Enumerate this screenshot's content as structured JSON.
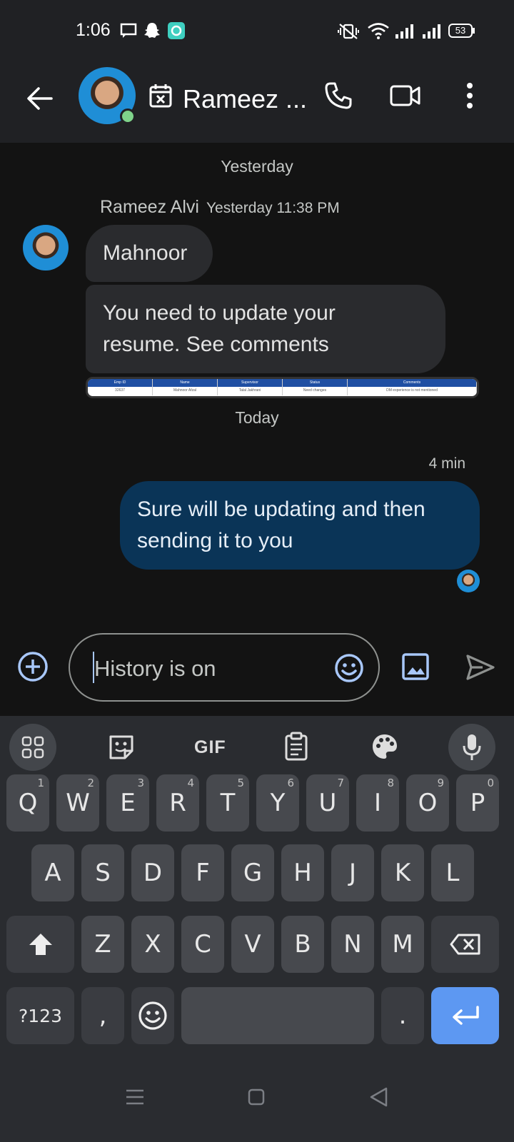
{
  "status_bar": {
    "time": "1:06",
    "battery": "53"
  },
  "header": {
    "contact_name": "Rameez ..."
  },
  "conversation": {
    "date_yesterday": "Yesterday",
    "sender_name": "Rameez Alvi",
    "sender_timestamp": "Yesterday 11:38 PM",
    "incoming": [
      {
        "lines": [
          "Mahnoor"
        ]
      },
      {
        "lines": [
          "You need to update your",
          "resume. See comments"
        ]
      }
    ],
    "attachment_table": {
      "headers": [
        "Emp ID",
        "Name",
        "Supervisor",
        "Status",
        "Comments"
      ],
      "row": [
        "32637",
        "Mahnoor Afzal",
        "Talal Jakhrani",
        "Need changes",
        "DM experience is not mentioned"
      ]
    },
    "date_today": "Today",
    "outgoing_time": "4 min",
    "outgoing": {
      "lines": [
        "Sure will be updating and then",
        "sending it to you"
      ]
    }
  },
  "composer": {
    "placeholder": "History is on"
  },
  "keyboard": {
    "toolbar_gif": "GIF",
    "row1": [
      [
        "Q",
        "1"
      ],
      [
        "W",
        "2"
      ],
      [
        "E",
        "3"
      ],
      [
        "R",
        "4"
      ],
      [
        "T",
        "5"
      ],
      [
        "Y",
        "6"
      ],
      [
        "U",
        "7"
      ],
      [
        "I",
        "8"
      ],
      [
        "O",
        "9"
      ],
      [
        "P",
        "0"
      ]
    ],
    "row2": [
      "A",
      "S",
      "D",
      "F",
      "G",
      "H",
      "J",
      "K",
      "L"
    ],
    "row3": [
      "Z",
      "X",
      "C",
      "V",
      "B",
      "N",
      "M"
    ],
    "symbols_key": "?123",
    "comma_key": ",",
    "period_key": "."
  },
  "colors": {
    "outgoing_bubble": "#0a3457",
    "incoming_bubble": "#2a2b2e",
    "enter_key": "#5d98f2"
  }
}
